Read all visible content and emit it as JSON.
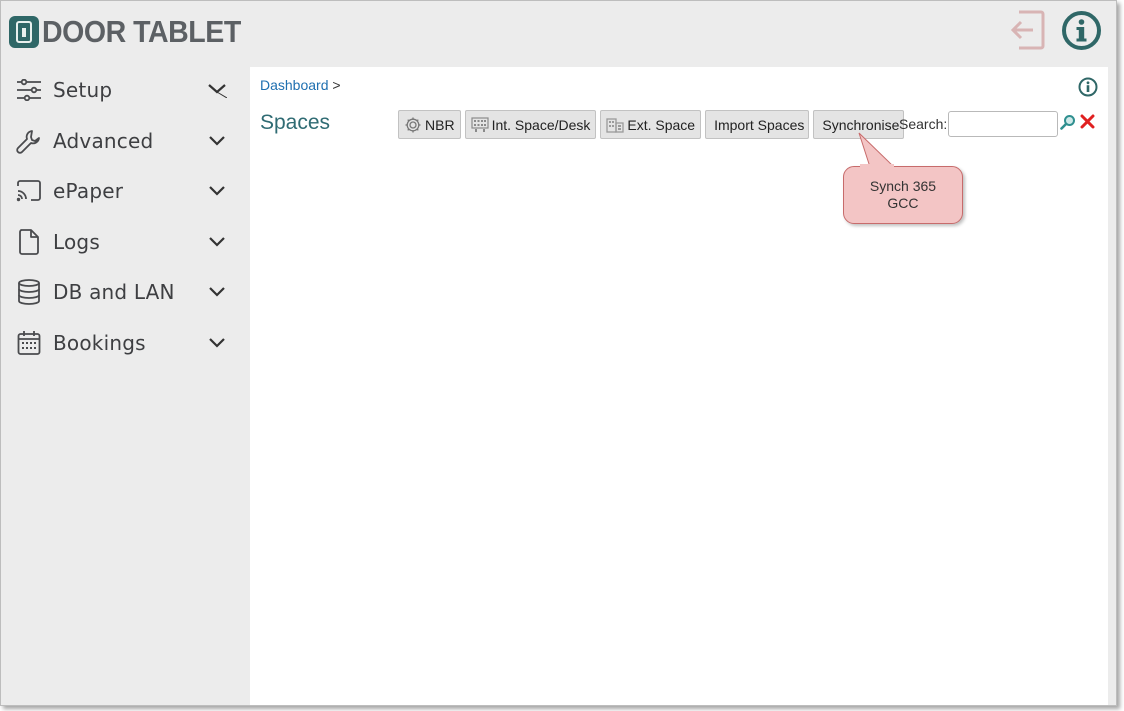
{
  "app": {
    "logo_text": "DOOR TABLET",
    "brand_color": "#2f6767"
  },
  "header": {
    "logout_icon": "logout-icon",
    "info_icon": "info-icon"
  },
  "sidebar": {
    "items": [
      {
        "label": "Setup",
        "icon": "sliders-icon"
      },
      {
        "label": "Advanced",
        "icon": "wrench-icon"
      },
      {
        "label": "ePaper",
        "icon": "cast-icon"
      },
      {
        "label": "Logs",
        "icon": "file-icon"
      },
      {
        "label": "DB and LAN",
        "icon": "database-icon"
      },
      {
        "label": "Bookings",
        "icon": "calendar-icon"
      }
    ]
  },
  "main": {
    "breadcrumb": {
      "link": "Dashboard",
      "separator": ">"
    },
    "title": "Spaces",
    "toolbar": {
      "nbr": "NBR",
      "int_space": "Int. Space/Desk",
      "ext_space": "Ext. Space",
      "import_spaces": "Import Spaces",
      "synchronise": "Synchronise"
    },
    "search": {
      "label": "Search:",
      "value": "",
      "placeholder": ""
    },
    "callout": "Synch 365\nGCC"
  },
  "colors": {
    "title": "#2f6b73",
    "link": "#1e6fb0",
    "callout_bg": "#f3c5c5",
    "callout_border": "#c76b6b",
    "clear_red": "#e02020",
    "search_teal": "#2f8f8f"
  }
}
